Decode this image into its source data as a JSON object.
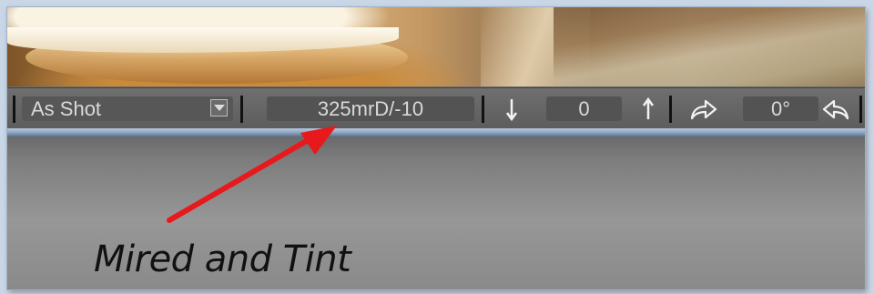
{
  "toolbar": {
    "white_balance_preset": "As Shot",
    "mired_tint_value": "325mrD/-10",
    "tint_value": "0",
    "rotation_value": "0°"
  },
  "annotation": {
    "caption": "Mired and Tint",
    "arrow_color": "#e8191c"
  },
  "icons": {
    "dropdown": "chevron-down-icon",
    "decrease": "arrow-down-icon",
    "increase": "arrow-up-icon",
    "rotate_right": "redo-arrow-icon",
    "rotate_left": "undo-arrow-icon"
  }
}
